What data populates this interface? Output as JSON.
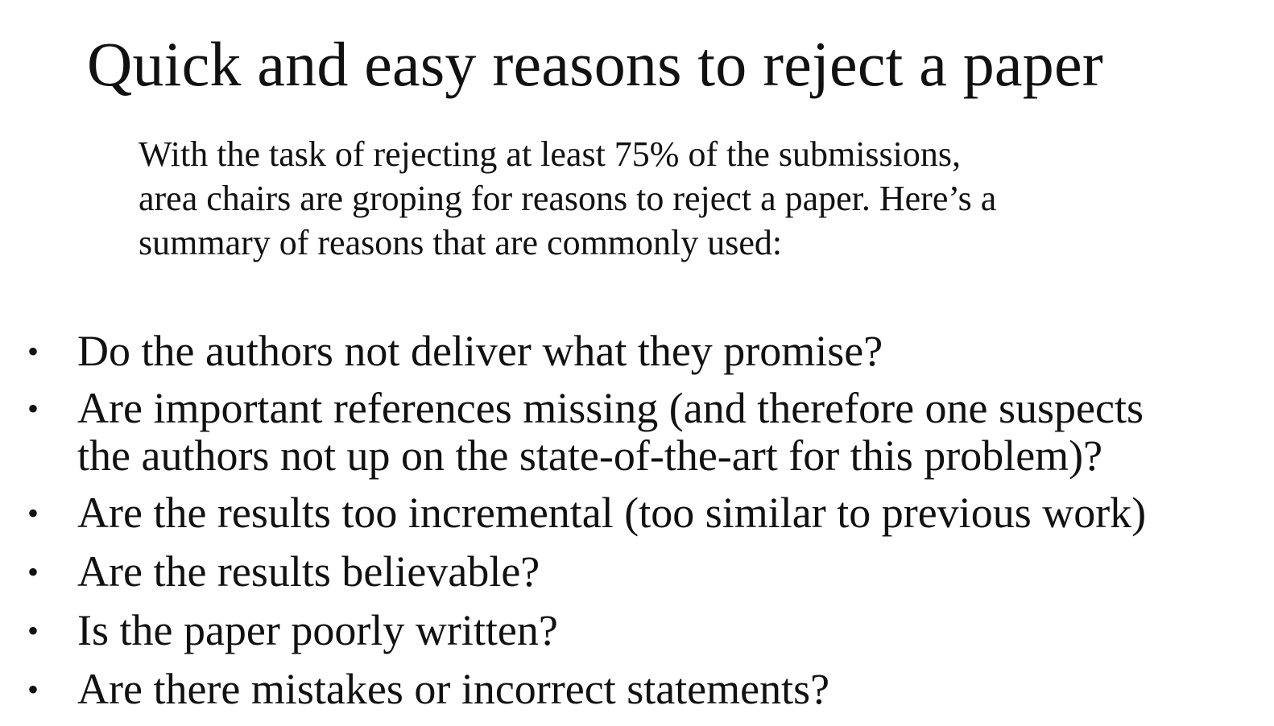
{
  "slide": {
    "title": "Quick and easy reasons to reject a paper",
    "intro_lines": [
      "With the task of rejecting at least 75% of the submissions,",
      "area chairs are groping for reasons to reject a paper.  Here’s a",
      "summary of reasons that are commonly used:"
    ],
    "bullet_symbol": "•",
    "bullets": [
      {
        "lines": [
          "Do the authors not deliver what they promise?"
        ]
      },
      {
        "lines": [
          "Are important references missing (and therefore one suspects",
          "the authors not up on the state-of-the-art for this problem)?"
        ]
      },
      {
        "lines": [
          "Are the results too incremental (too similar to previous work)"
        ]
      },
      {
        "lines": [
          "Are the results believable?"
        ]
      },
      {
        "lines": [
          "Is the paper poorly written?"
        ]
      },
      {
        "lines": [
          "Are there mistakes or incorrect statements?"
        ]
      }
    ]
  }
}
